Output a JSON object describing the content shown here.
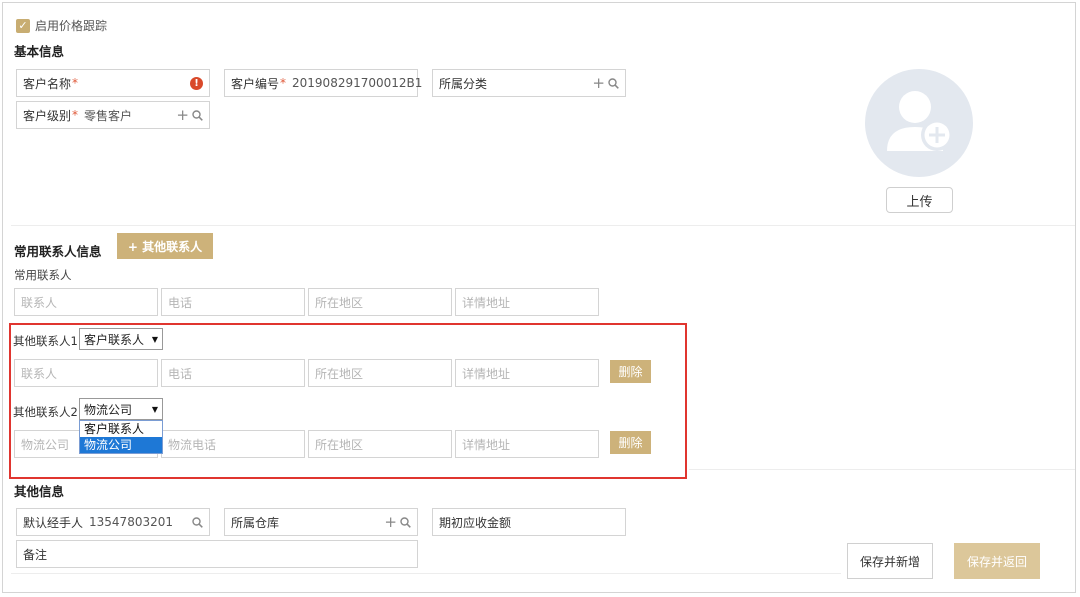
{
  "price_tracking": {
    "label": "启用价格跟踪",
    "checked": true
  },
  "basic_info": {
    "title": "基本信息",
    "customer_name": {
      "label": "客户名称",
      "required_mark": "*",
      "value": ""
    },
    "customer_code": {
      "label": "客户编号",
      "required_mark": "*",
      "value": "2019082917000​12B1"
    },
    "category": {
      "label": "所属分类",
      "value": ""
    },
    "customer_level": {
      "label": "客户级别",
      "required_mark": "*",
      "value": "零售客户"
    }
  },
  "avatar": {
    "upload_label": "上传"
  },
  "contacts": {
    "title": "常用联系人信息",
    "add_other_button": "+ 其他联系人",
    "common_label": "常用联系人",
    "common_row": {
      "contact": "联系人",
      "phone": "电话",
      "region": "所在地区",
      "address": "详情地址"
    },
    "other1": {
      "label": "其他联系人1",
      "type_selected": "客户联系人",
      "row": {
        "contact": "联系人",
        "phone": "电话",
        "region": "所在地区",
        "address": "详情地址"
      },
      "delete_label": "删除"
    },
    "other2": {
      "label": "其他联系人2",
      "type_selected": "物流公司",
      "options": [
        "客户联系人",
        "物流公司"
      ],
      "row": {
        "contact": "物流公司",
        "phone": "物流电话",
        "region": "所在地区",
        "address": "详情地址"
      },
      "delete_label": "删除"
    }
  },
  "other_info": {
    "title": "其他信息",
    "handler": {
      "label": "默认经手人",
      "value": "13547803201"
    },
    "warehouse": {
      "label": "所属仓库",
      "value": ""
    },
    "receivable": {
      "label": "期初应收金额",
      "value": ""
    },
    "remark": {
      "label": "备注",
      "value": ""
    }
  },
  "actions": {
    "save_new": "保存并新增",
    "save_return": "保存并返回"
  },
  "colors": {
    "accent": "#cdb27a",
    "error": "#d9492a",
    "highlight_border": "#e0352f",
    "selected_option": "#1e78d6"
  },
  "icons": [
    "check-icon",
    "error-icon",
    "plus-icon",
    "search-icon",
    "user-add-icon",
    "caret-down-icon"
  ]
}
